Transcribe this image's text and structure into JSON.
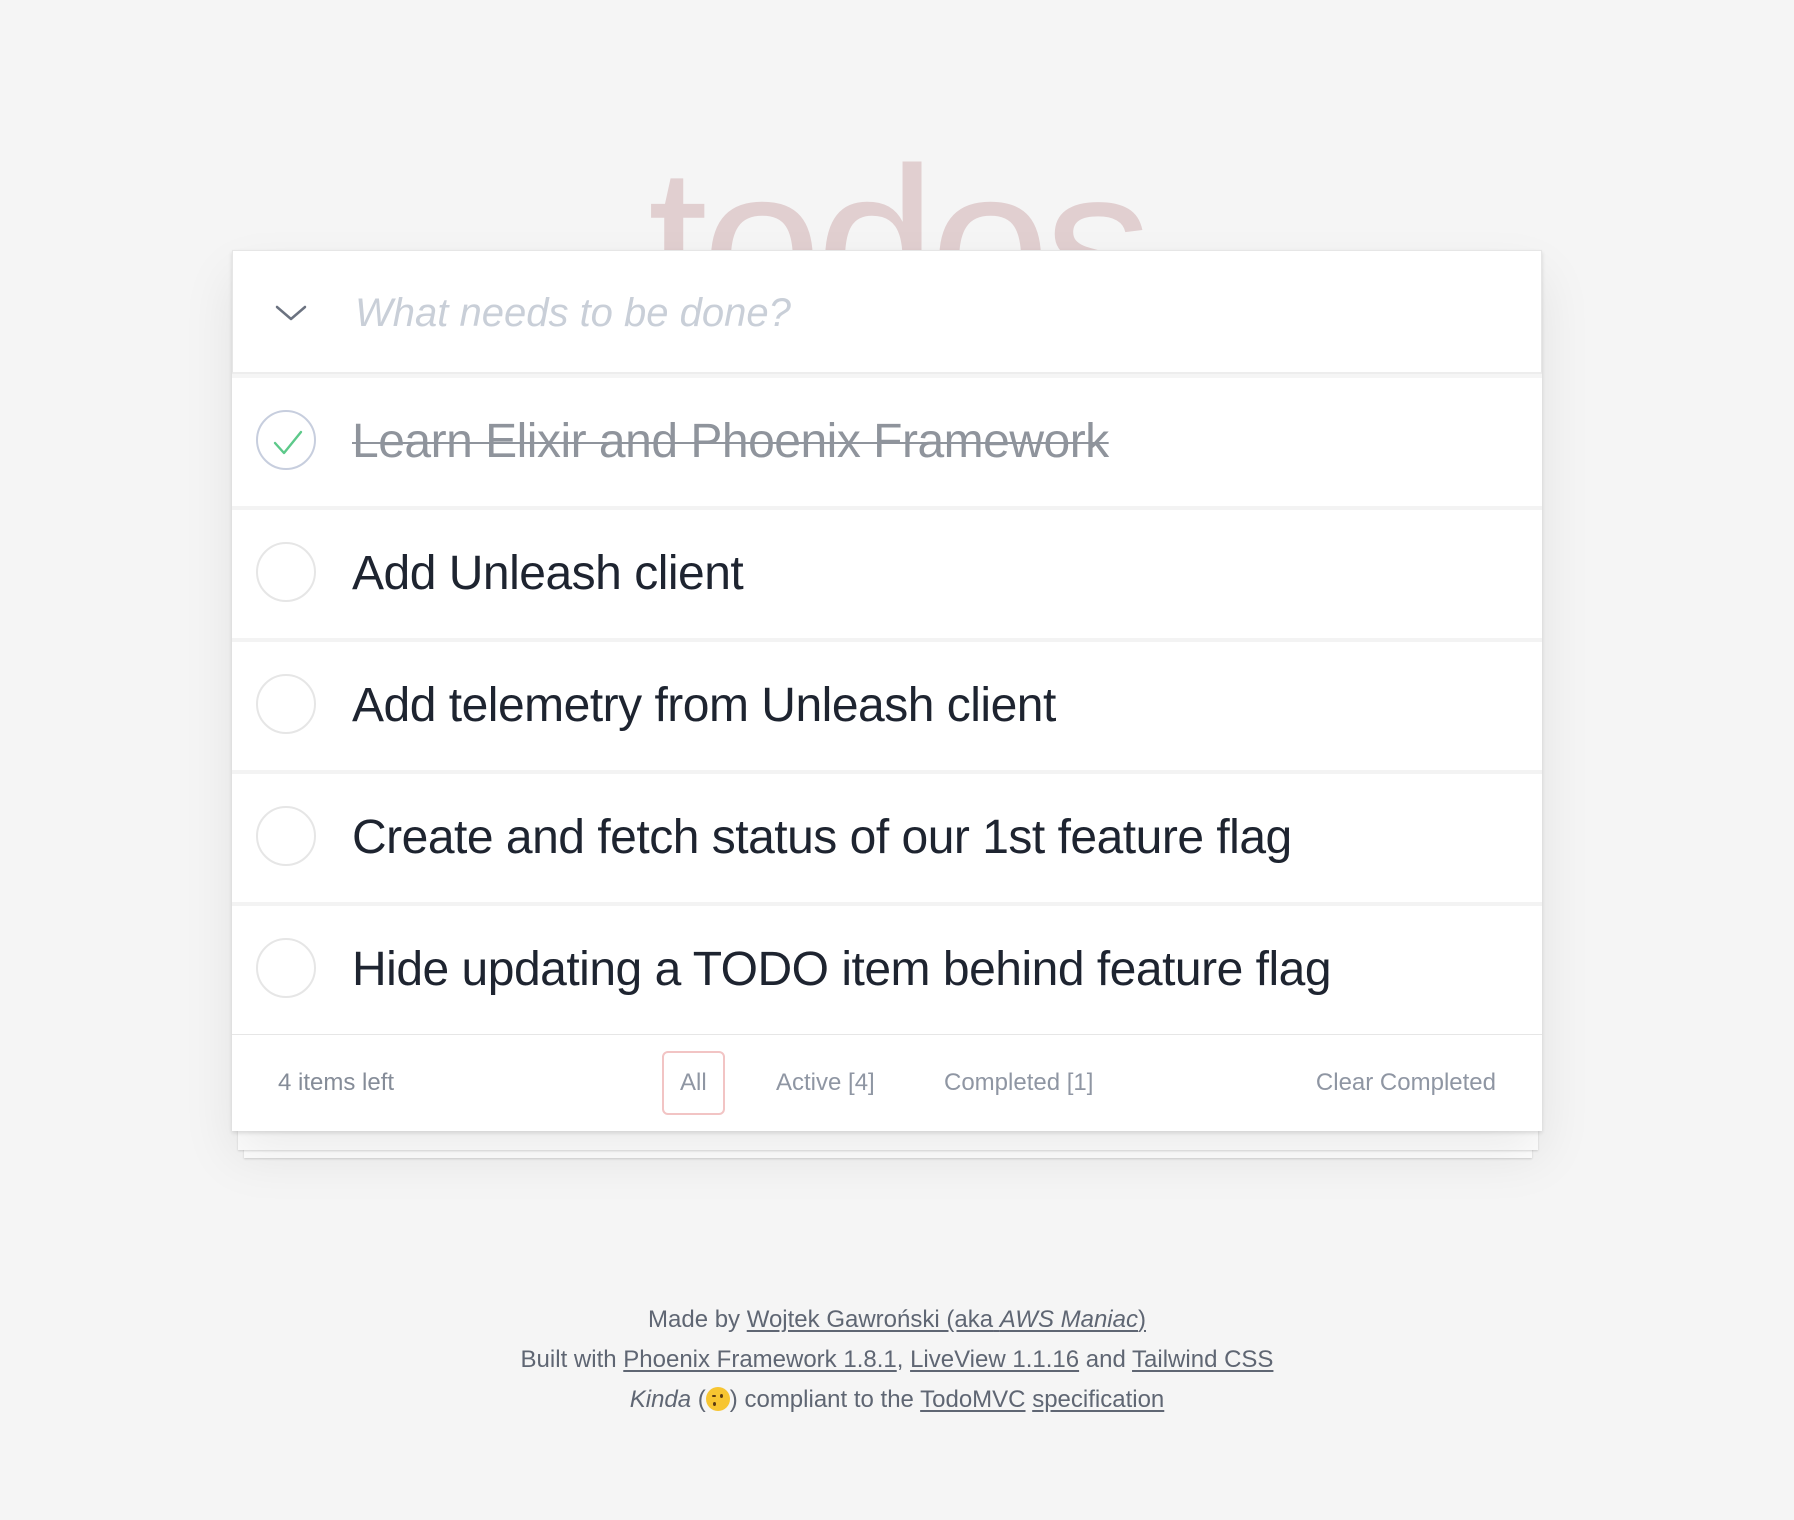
{
  "app_title": "todos",
  "new_todo": {
    "placeholder": "What needs to be done?",
    "value": ""
  },
  "todos": [
    {
      "label": "Learn Elixir and Phoenix Framework",
      "completed": true
    },
    {
      "label": "Add Unleash client",
      "completed": false
    },
    {
      "label": "Add telemetry from Unleash client",
      "completed": false
    },
    {
      "label": "Create and fetch status of our 1st feature flag",
      "completed": false
    },
    {
      "label": "Hide updating a TODO item behind feature flag",
      "completed": false
    }
  ],
  "footer": {
    "items_left": "4 items left",
    "filters": {
      "all": "All",
      "active": "Active [4]",
      "completed": "Completed [1]"
    },
    "selected_filter": "All",
    "clear_completed": "Clear Completed"
  },
  "info": {
    "line1": {
      "made_by": "Made by",
      "author_link": "Wojtek Gawroński (aka",
      "alias": "AWS Maniac",
      "author_link_end": ")"
    },
    "line2": {
      "built_with": "Built with",
      "phoenix_link": "Phoenix Framework 1.8.1",
      "comma": ",",
      "liveview_link": "LiveView 1.1.16",
      "and": "and",
      "tailwind_link": "Tailwind CSS"
    },
    "line3": {
      "kinda": "Kinda",
      "open_paren": "(",
      "close_paren": ")",
      "compliant": "compliant to the",
      "todomvc_link": "TodoMVC",
      "spec_link": "specification"
    }
  },
  "colors": {
    "title": "#e1cfd0",
    "check_done": "#5dc98a",
    "selected_filter_border": "#f2c4c4",
    "background": "#f5f5f5"
  },
  "icons": {
    "toggle_all": "chevron-down-icon",
    "done": "checkmark-icon",
    "emoji": "winking-face-icon"
  }
}
